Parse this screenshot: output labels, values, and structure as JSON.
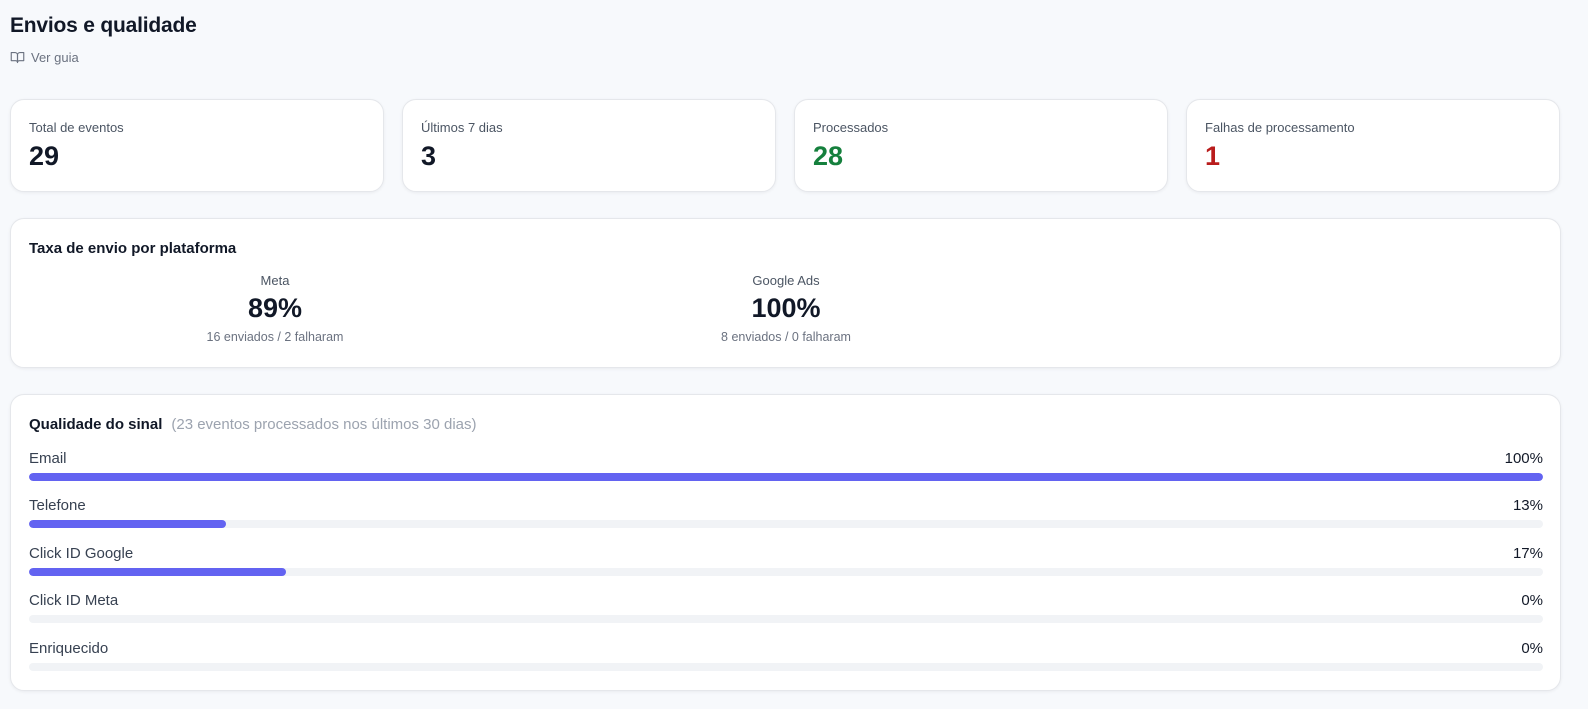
{
  "header": {
    "title": "Envios e qualidade",
    "guide_link": "Ver guia",
    "guide_icon": "book-open-icon"
  },
  "stats": [
    {
      "label": "Total de eventos",
      "value": "29",
      "color": "#111827"
    },
    {
      "label": "Últimos 7 dias",
      "value": "3",
      "color": "#111827"
    },
    {
      "label": "Processados",
      "value": "28",
      "color": "#15803d"
    },
    {
      "label": "Falhas de processamento",
      "value": "1",
      "color": "#b91c1c"
    }
  ],
  "platforms": {
    "title": "Taxa de envio por plataforma",
    "items": [
      {
        "name": "Meta",
        "rate": "89%",
        "detail": "16 enviados / 2 falharam"
      },
      {
        "name": "Google Ads",
        "rate": "100%",
        "detail": "8 enviados / 0 falharam"
      }
    ]
  },
  "quality": {
    "title": "Qualidade do sinal",
    "subtitle": "(23 eventos processados nos últimos 30 dias)",
    "bar_color": "#6363f1",
    "metrics": [
      {
        "label": "Email",
        "value": "100%",
        "percent": 100
      },
      {
        "label": "Telefone",
        "value": "13%",
        "percent": 13
      },
      {
        "label": "Click ID Google",
        "value": "17%",
        "percent": 17
      },
      {
        "label": "Click ID Meta",
        "value": "0%",
        "percent": 0
      },
      {
        "label": "Enriquecido",
        "value": "0%",
        "percent": 0
      }
    ]
  }
}
